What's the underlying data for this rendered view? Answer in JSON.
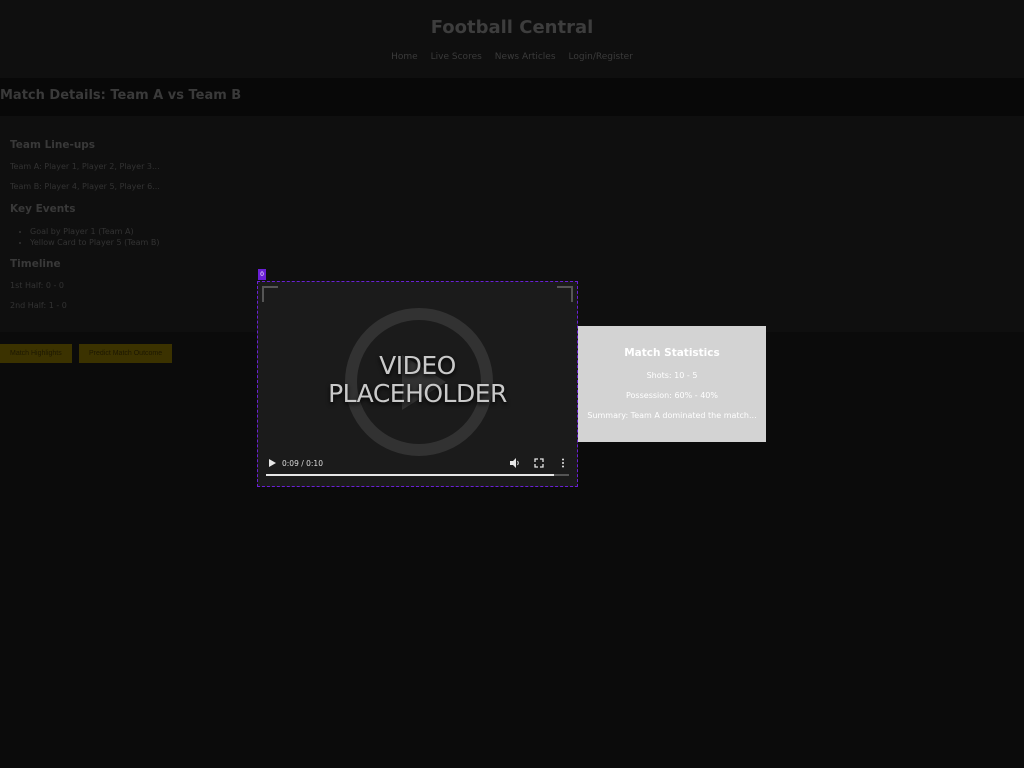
{
  "site": {
    "title": "Football Central",
    "nav": [
      "Home",
      "Live Scores",
      "News Articles",
      "Login/Register"
    ]
  },
  "match": {
    "title": "Match Details: Team A vs Team B"
  },
  "lineups": {
    "heading": "Team Line-ups",
    "team_a": "Team A: Player 1, Player 2, Player 3...",
    "team_b": "Team B: Player 4, Player 5, Player 6..."
  },
  "events": {
    "heading": "Key Events",
    "items": [
      "Goal by Player 1 (Team A)",
      "Yellow Card to Player 5 (Team B)"
    ]
  },
  "timeline": {
    "heading": "Timeline",
    "first_half": "1st Half: 0 - 0",
    "second_half": "2nd Half: 1 - 0"
  },
  "actions": {
    "highlights": "Match Highlights",
    "predict": "Predict Match Outcome"
  },
  "video": {
    "badge": "0",
    "placeholder_line1": "VIDEO",
    "placeholder_line2": "PLACEHOLDER",
    "time": "0:09 / 0:10",
    "progress": 0.95
  },
  "stats": {
    "heading": "Match Statistics",
    "shots": "Shots: 10 - 5",
    "possession": "Possession: 60% - 40%",
    "summary": "Summary: Team A dominated the match..."
  },
  "colors": {
    "accent": "#6a1fd6",
    "button": "#3b3200",
    "stats_bg": "#d3d3d3"
  }
}
